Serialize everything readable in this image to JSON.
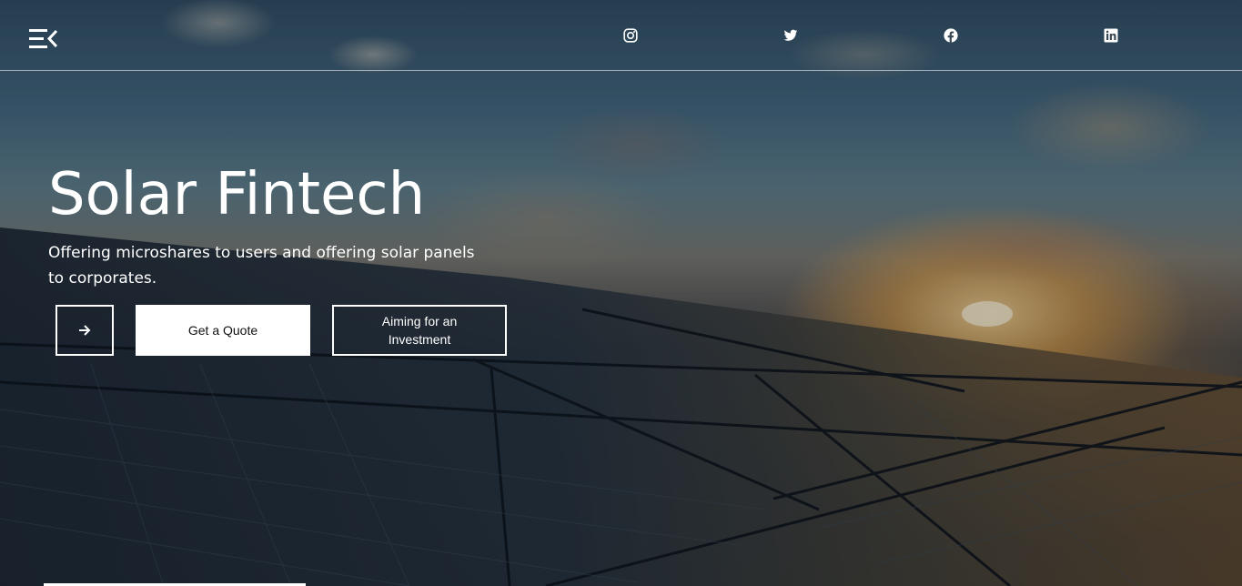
{
  "header": {
    "menu_icon": "menu-collapse-icon",
    "social": [
      {
        "name": "instagram",
        "icon": "instagram-icon"
      },
      {
        "name": "twitter",
        "icon": "twitter-icon"
      },
      {
        "name": "facebook",
        "icon": "facebook-icon"
      },
      {
        "name": "linkedin",
        "icon": "linkedin-icon"
      }
    ]
  },
  "hero": {
    "title": "Solar Fintech",
    "subtitle": "Offering microshares to users and offering solar panels to corporates.",
    "arrow_icon": "arrow-right-icon",
    "quote_label": "Get a Quote",
    "invest_label": "Aiming for an Investment"
  },
  "colors": {
    "text": "#ffffff",
    "button_bg": "#ffffff",
    "button_text": "#111111"
  }
}
